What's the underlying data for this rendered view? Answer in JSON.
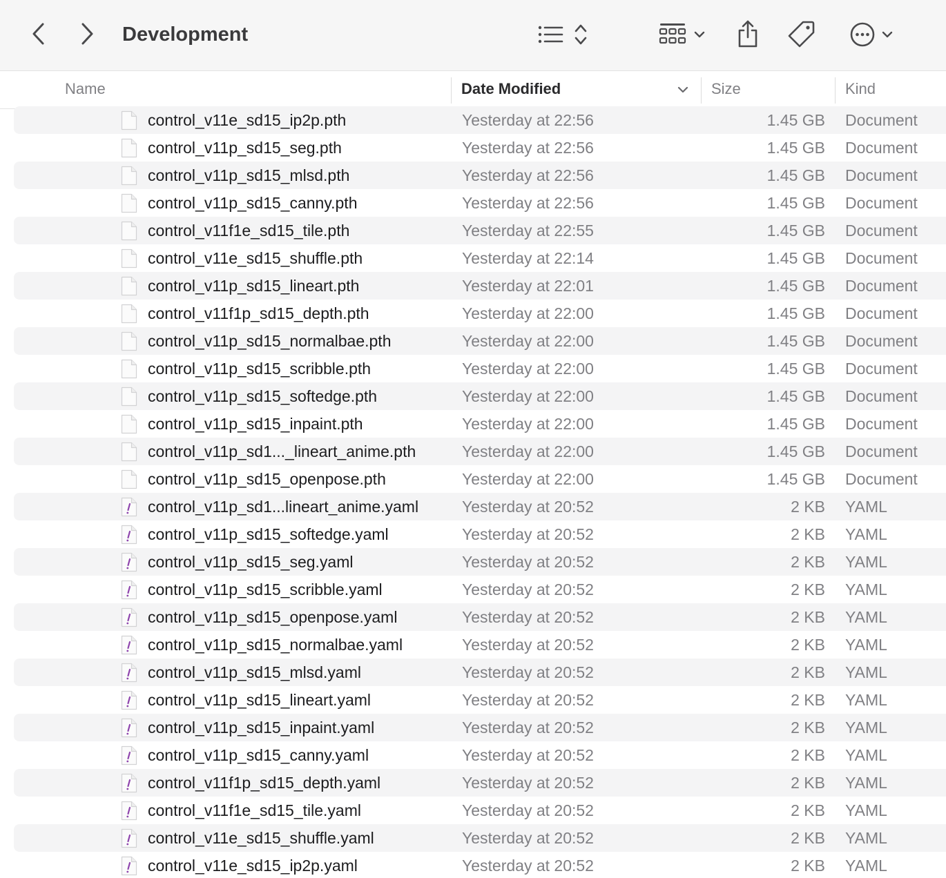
{
  "window": {
    "title": "Development"
  },
  "toolbar": {
    "back_icon": "chevron-left-icon",
    "forward_icon": "chevron-right-icon",
    "list_view_icon": "list-view-icon",
    "sort_icon": "up-down-arrows-icon",
    "group_icon": "grid-icon",
    "group_chevron_icon": "chevron-down-icon",
    "share_icon": "share-icon",
    "tag_icon": "tag-icon",
    "more_icon": "ellipsis-circle-icon",
    "more_chevron_icon": "chevron-down-icon"
  },
  "columns": {
    "name": "Name",
    "date": "Date Modified",
    "size": "Size",
    "kind": "Kind",
    "sort_indicator_icon": "chevron-down-icon"
  },
  "colors": {
    "row_stripe": "#f4f4f5",
    "yaml_icon_accent": "#8e44ad",
    "secondary_text": "#808084"
  },
  "files": [
    {
      "name": "control_v11e_sd15_ip2p.pth",
      "date": "Yesterday at 22:56",
      "size": "1.45 GB",
      "kind": "Document",
      "icon": "document-icon"
    },
    {
      "name": "control_v11p_sd15_seg.pth",
      "date": "Yesterday at 22:56",
      "size": "1.45 GB",
      "kind": "Document",
      "icon": "document-icon"
    },
    {
      "name": "control_v11p_sd15_mlsd.pth",
      "date": "Yesterday at 22:56",
      "size": "1.45 GB",
      "kind": "Document",
      "icon": "document-icon"
    },
    {
      "name": "control_v11p_sd15_canny.pth",
      "date": "Yesterday at 22:56",
      "size": "1.45 GB",
      "kind": "Document",
      "icon": "document-icon"
    },
    {
      "name": "control_v11f1e_sd15_tile.pth",
      "date": "Yesterday at 22:55",
      "size": "1.45 GB",
      "kind": "Document",
      "icon": "document-icon"
    },
    {
      "name": "control_v11e_sd15_shuffle.pth",
      "date": "Yesterday at 22:14",
      "size": "1.45 GB",
      "kind": "Document",
      "icon": "document-icon"
    },
    {
      "name": "control_v11p_sd15_lineart.pth",
      "date": "Yesterday at 22:01",
      "size": "1.45 GB",
      "kind": "Document",
      "icon": "document-icon"
    },
    {
      "name": "control_v11f1p_sd15_depth.pth",
      "date": "Yesterday at 22:00",
      "size": "1.45 GB",
      "kind": "Document",
      "icon": "document-icon"
    },
    {
      "name": "control_v11p_sd15_normalbae.pth",
      "date": "Yesterday at 22:00",
      "size": "1.45 GB",
      "kind": "Document",
      "icon": "document-icon"
    },
    {
      "name": "control_v11p_sd15_scribble.pth",
      "date": "Yesterday at 22:00",
      "size": "1.45 GB",
      "kind": "Document",
      "icon": "document-icon"
    },
    {
      "name": "control_v11p_sd15_softedge.pth",
      "date": "Yesterday at 22:00",
      "size": "1.45 GB",
      "kind": "Document",
      "icon": "document-icon"
    },
    {
      "name": "control_v11p_sd15_inpaint.pth",
      "date": "Yesterday at 22:00",
      "size": "1.45 GB",
      "kind": "Document",
      "icon": "document-icon"
    },
    {
      "name": "control_v11p_sd1..._lineart_anime.pth",
      "date": "Yesterday at 22:00",
      "size": "1.45 GB",
      "kind": "Document",
      "icon": "document-icon"
    },
    {
      "name": "control_v11p_sd15_openpose.pth",
      "date": "Yesterday at 22:00",
      "size": "1.45 GB",
      "kind": "Document",
      "icon": "document-icon"
    },
    {
      "name": "control_v11p_sd1...lineart_anime.yaml",
      "date": "Yesterday at 20:52",
      "size": "2 KB",
      "kind": "YAML",
      "icon": "yaml-file-icon"
    },
    {
      "name": "control_v11p_sd15_softedge.yaml",
      "date": "Yesterday at 20:52",
      "size": "2 KB",
      "kind": "YAML",
      "icon": "yaml-file-icon"
    },
    {
      "name": "control_v11p_sd15_seg.yaml",
      "date": "Yesterday at 20:52",
      "size": "2 KB",
      "kind": "YAML",
      "icon": "yaml-file-icon"
    },
    {
      "name": "control_v11p_sd15_scribble.yaml",
      "date": "Yesterday at 20:52",
      "size": "2 KB",
      "kind": "YAML",
      "icon": "yaml-file-icon"
    },
    {
      "name": "control_v11p_sd15_openpose.yaml",
      "date": "Yesterday at 20:52",
      "size": "2 KB",
      "kind": "YAML",
      "icon": "yaml-file-icon"
    },
    {
      "name": "control_v11p_sd15_normalbae.yaml",
      "date": "Yesterday at 20:52",
      "size": "2 KB",
      "kind": "YAML",
      "icon": "yaml-file-icon"
    },
    {
      "name": "control_v11p_sd15_mlsd.yaml",
      "date": "Yesterday at 20:52",
      "size": "2 KB",
      "kind": "YAML",
      "icon": "yaml-file-icon"
    },
    {
      "name": "control_v11p_sd15_lineart.yaml",
      "date": "Yesterday at 20:52",
      "size": "2 KB",
      "kind": "YAML",
      "icon": "yaml-file-icon"
    },
    {
      "name": "control_v11p_sd15_inpaint.yaml",
      "date": "Yesterday at 20:52",
      "size": "2 KB",
      "kind": "YAML",
      "icon": "yaml-file-icon"
    },
    {
      "name": "control_v11p_sd15_canny.yaml",
      "date": "Yesterday at 20:52",
      "size": "2 KB",
      "kind": "YAML",
      "icon": "yaml-file-icon"
    },
    {
      "name": "control_v11f1p_sd15_depth.yaml",
      "date": "Yesterday at 20:52",
      "size": "2 KB",
      "kind": "YAML",
      "icon": "yaml-file-icon"
    },
    {
      "name": "control_v11f1e_sd15_tile.yaml",
      "date": "Yesterday at 20:52",
      "size": "2 KB",
      "kind": "YAML",
      "icon": "yaml-file-icon"
    },
    {
      "name": "control_v11e_sd15_shuffle.yaml",
      "date": "Yesterday at 20:52",
      "size": "2 KB",
      "kind": "YAML",
      "icon": "yaml-file-icon"
    },
    {
      "name": "control_v11e_sd15_ip2p.yaml",
      "date": "Yesterday at 20:52",
      "size": "2 KB",
      "kind": "YAML",
      "icon": "yaml-file-icon"
    }
  ]
}
